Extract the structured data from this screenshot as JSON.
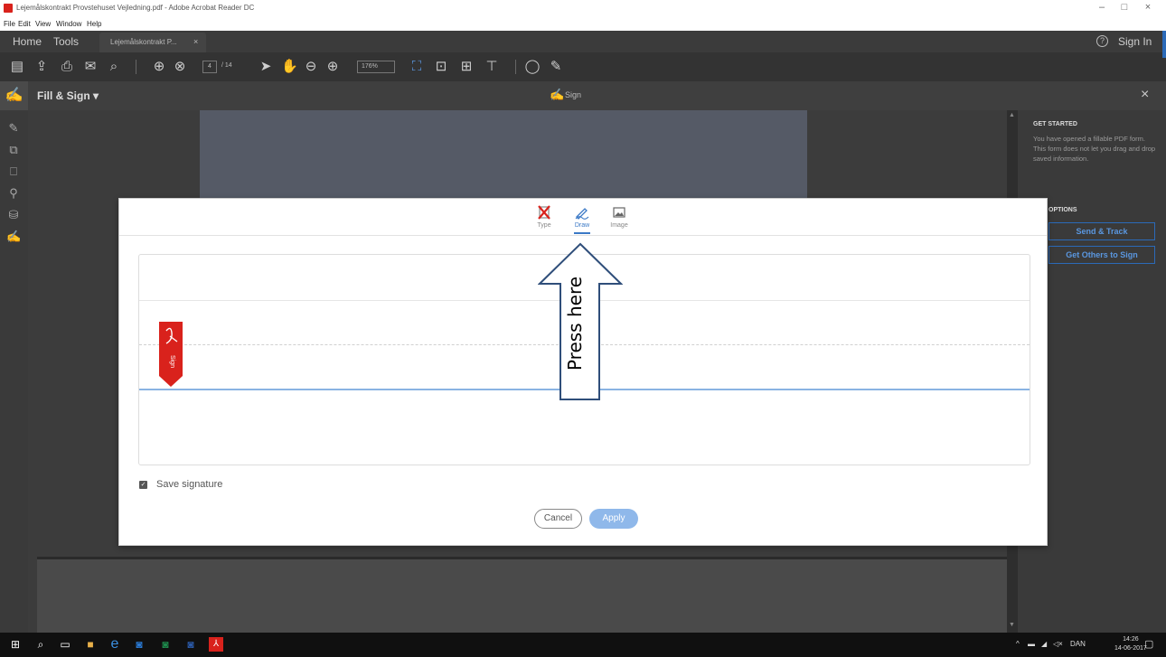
{
  "window": {
    "title": "Lejemålskontrakt Provstehuset Vejledning.pdf - Adobe Acrobat Reader DC",
    "min_icon": "minimize-icon",
    "max_icon": "maximize-icon",
    "close_icon": "close-icon"
  },
  "menubar": {
    "items": [
      "File",
      "Edit",
      "View",
      "Window",
      "Help"
    ]
  },
  "tabbar": {
    "home": "Home",
    "tools": "Tools",
    "doc_tab": "Lejemålskontrakt P...",
    "doc_tab_close": "×",
    "help": "?",
    "sign_in": "Sign In"
  },
  "toolbar": {
    "page_current": "4",
    "page_total": "/ 14",
    "zoom": "176%"
  },
  "fillbar": {
    "title": "Fill & Sign",
    "sign": "Sign",
    "close": "×"
  },
  "right_panel": {
    "get_started_heading": "GET STARTED",
    "get_started_text": "You have opened a fillable PDF form. This form does not let you drag and drop saved information.",
    "options_heading": "OPTIONS",
    "send_track": "Send & Track",
    "get_others": "Get Others to Sign"
  },
  "dialog": {
    "tabs": [
      {
        "label": "Type",
        "icon": "type-icon"
      },
      {
        "label": "Draw",
        "icon": "draw-pen-icon"
      },
      {
        "label": "Image",
        "icon": "image-icon"
      }
    ],
    "active_tab": "Draw",
    "flag_label": "Sign",
    "save_signature": "Save signature",
    "save_checked": true,
    "cancel": "Cancel",
    "apply": "Apply"
  },
  "annotation": {
    "text": "Press here"
  },
  "taskbar": {
    "language": "DAN",
    "time": "14:26",
    "date": "14-06-2017"
  },
  "colors": {
    "accent_blue": "#3b79c6",
    "acrobat_red": "#d9221c",
    "apply_disabled": "#8fb8ea"
  }
}
